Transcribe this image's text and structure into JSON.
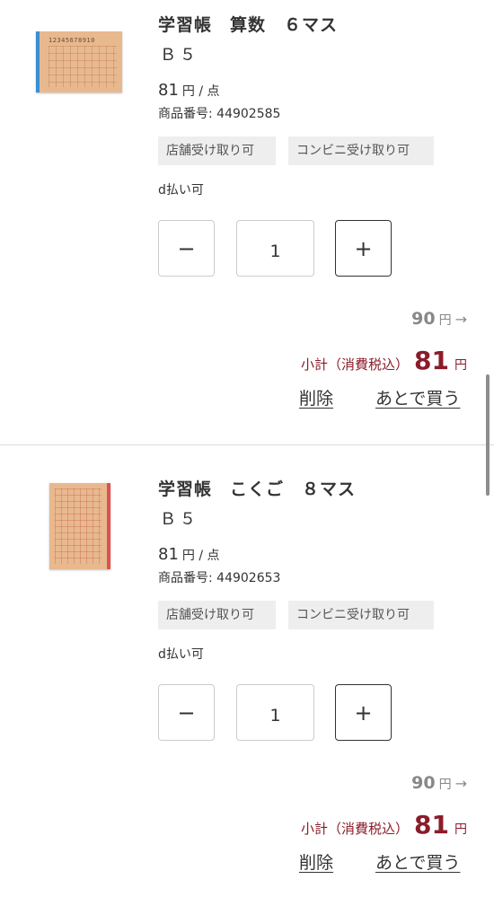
{
  "items": [
    {
      "name": "学習帳　算数　６マス",
      "size": "Ｂ５",
      "thumb_digits": "12345678910",
      "price": "81",
      "price_unit": "円 / 点",
      "product_code": "商品番号: 44902585",
      "tags": [
        "店舗受け取り可",
        "コンビニ受け取り可"
      ],
      "payment": "d払い可",
      "quantity": "1",
      "minus_label": "−",
      "plus_label": "+",
      "original_price": "90",
      "original_price_unit": "円",
      "arrow": "→",
      "subtotal_label": "小計（消費税込）",
      "subtotal_amount": "81",
      "subtotal_unit": "円",
      "delete_label": "削除",
      "later_label": "あとで買う"
    },
    {
      "name": "学習帳　こくご　８マス",
      "size": "Ｂ５",
      "price": "81",
      "price_unit": "円 / 点",
      "product_code": "商品番号: 44902653",
      "tags": [
        "店舗受け取り可",
        "コンビニ受け取り可"
      ],
      "payment": "d払い可",
      "quantity": "1",
      "minus_label": "−",
      "plus_label": "+",
      "original_price": "90",
      "original_price_unit": "円",
      "arrow": "→",
      "subtotal_label": "小計（消費税込）",
      "subtotal_amount": "81",
      "subtotal_unit": "円",
      "delete_label": "削除",
      "later_label": "あとで買う"
    }
  ],
  "colors": {
    "subtotal": "#8a1c2a",
    "tag_bg": "#eeeeee",
    "thumb_paper": "#e8b98e",
    "thumb_1_spine": "#3a8fd3",
    "thumb_2_spine": "#e05050"
  }
}
